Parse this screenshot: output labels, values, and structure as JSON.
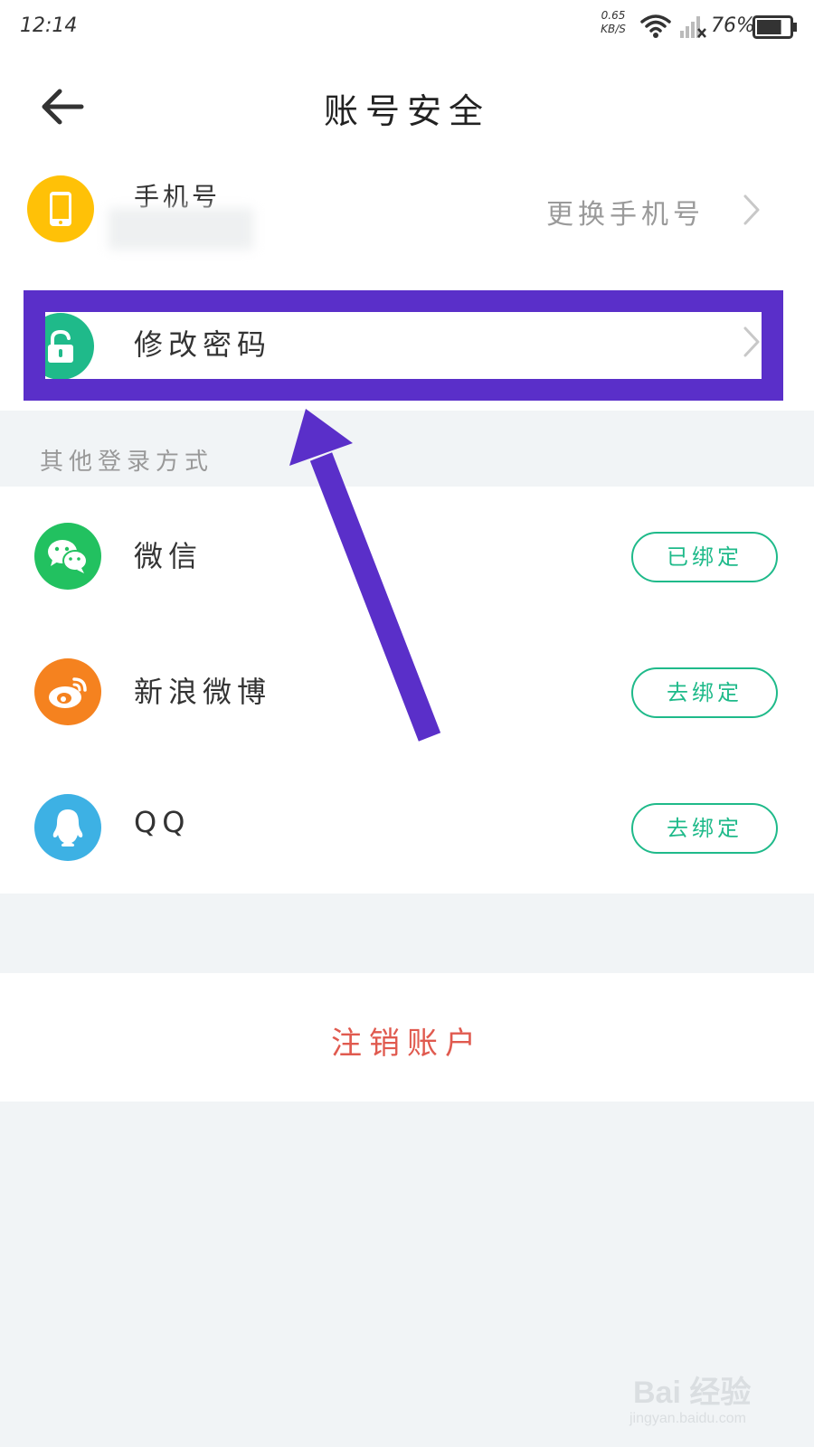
{
  "status_bar": {
    "time": "12:14",
    "net_speed_value": "0.65",
    "net_speed_unit": "KB/S",
    "battery_percent": "76%",
    "battery_level": 0.76
  },
  "header": {
    "title": "账号安全",
    "back_icon": "arrow-left-icon"
  },
  "phone": {
    "label": "手机号",
    "action": "更换手机号",
    "icon": "phone-icon",
    "icon_color": "#ffc107"
  },
  "password": {
    "label": "修改密码",
    "icon": "unlock-icon",
    "icon_color": "#1fba8a"
  },
  "other_login": {
    "section_label": "其他登录方式",
    "items": [
      {
        "name": "微信",
        "status": "已绑定",
        "icon": "wechat-icon",
        "color": "#22c160"
      },
      {
        "name": "新浪微博",
        "status": "去绑定",
        "icon": "weibo-icon",
        "color": "#f5821f"
      },
      {
        "name": "QQ",
        "status": "去绑定",
        "icon": "qq-icon",
        "color": "#3db1e4"
      }
    ]
  },
  "cancel_account": {
    "label": "注销账户",
    "color": "#e05a4f"
  },
  "annotation": {
    "color": "#5a2fc9"
  },
  "watermark": {
    "text": "Bai 经验",
    "sub": "jingyan.baidu.com"
  },
  "colors": {
    "accent": "#1fba8a",
    "background": "#f1f4f6"
  }
}
